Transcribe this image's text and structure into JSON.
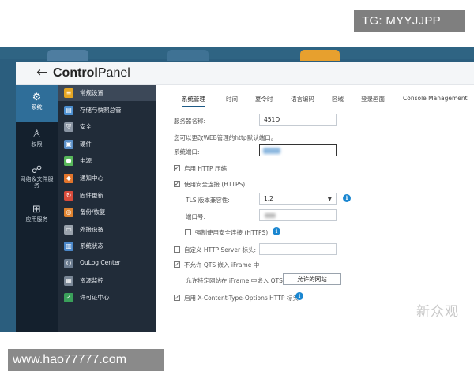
{
  "watermarks": {
    "top": "TG: MYYJJPP",
    "bottom": "www.hao77777.com",
    "brand": "新众观"
  },
  "window": {
    "title_bold": "Control",
    "title_light": "Panel",
    "back_icon": "arrow-left-icon"
  },
  "nav": {
    "items": [
      {
        "icon": "gear-icon",
        "glyph": "⚙",
        "label": "系统",
        "active": true
      },
      {
        "icon": "user-icon",
        "glyph": "♙",
        "label": "权限",
        "active": false
      },
      {
        "icon": "network-icon",
        "glyph": "☍",
        "label": "网络＆文件服务",
        "active": false
      },
      {
        "icon": "apps-icon",
        "glyph": "⊞",
        "label": "应用服务",
        "active": false
      }
    ]
  },
  "submenu": {
    "items": [
      {
        "label": "常规设置",
        "color": "#e5a523",
        "glyph": "≡",
        "active": true
      },
      {
        "label": "存储与快照总管",
        "color": "#4b8fd1",
        "glyph": "▤",
        "active": false
      },
      {
        "label": "安全",
        "color": "#8a95a3",
        "glyph": "⛨",
        "active": false
      },
      {
        "label": "硬件",
        "color": "#5a8fc8",
        "glyph": "▣",
        "active": false
      },
      {
        "label": "电源",
        "color": "#58b85b",
        "glyph": "●",
        "active": false
      },
      {
        "label": "通知中心",
        "color": "#e2752c",
        "glyph": "◆",
        "active": false
      },
      {
        "label": "固件更新",
        "color": "#d94b3b",
        "glyph": "↻",
        "active": false
      },
      {
        "label": "备份/恢复",
        "color": "#e0832f",
        "glyph": "◎",
        "active": false
      },
      {
        "label": "外接设备",
        "color": "#9aa3ad",
        "glyph": "▭",
        "active": false
      },
      {
        "label": "系统状态",
        "color": "#4a87c9",
        "glyph": "▥",
        "active": false
      },
      {
        "label": "QuLog Center",
        "color": "#6b7c90",
        "glyph": "Q",
        "active": false
      },
      {
        "label": "资源监控",
        "color": "#7a8796",
        "glyph": "▦",
        "active": false
      },
      {
        "label": "许可证中心",
        "color": "#3aa05a",
        "glyph": "✓",
        "active": false
      }
    ]
  },
  "tabs": [
    "系统管理",
    "时间",
    "夏令时",
    "语言编码",
    "区域",
    "登录画面",
    "Console Management"
  ],
  "form": {
    "server_name_label": "服务器名称:",
    "server_name_value": "451D",
    "port_hint": "您可以更改WEB管理的http默认端口。",
    "system_port_label": "系统端口:",
    "http_compress_label": "启用 HTTP 压缩",
    "https_label": "使用安全连接 (HTTPS)",
    "tls_label": "TLS 版本兼容性:",
    "tls_value": "1.2",
    "port_label": "端口号:",
    "force_https_label": "强制使用安全连接 (HTTPS)",
    "custom_header_label": "自定义 HTTP Server 标头:",
    "iframe_block_label": "不允许 QTS 嵌入 iFrame 中",
    "iframe_allow_label": "允许特定网站在 iFrame 中嵌入 QTS",
    "allowed_sites_button": "允许的网站",
    "xcto_label": "启用 X-Content-Type-Options HTTP 标头",
    "check_glyph": "✓",
    "info_glyph": "i",
    "caret_glyph": "▼"
  }
}
